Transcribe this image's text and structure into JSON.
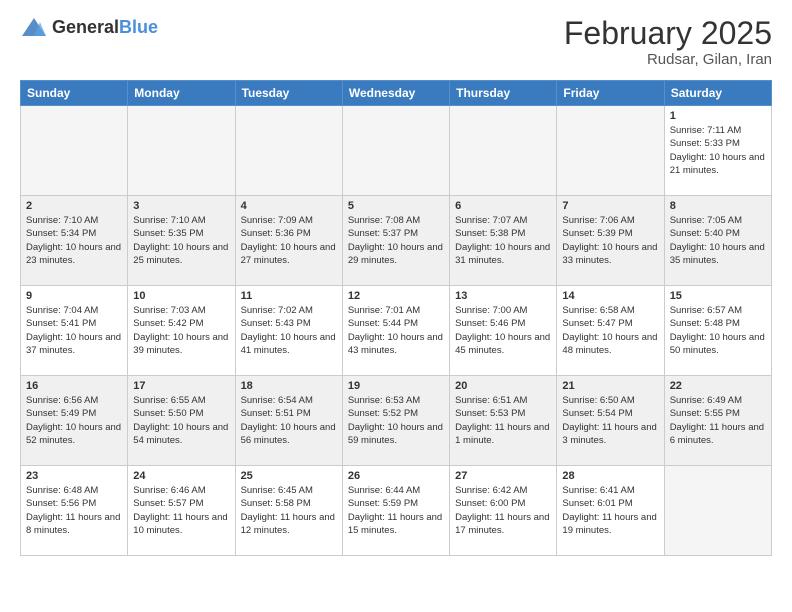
{
  "header": {
    "logo_general": "General",
    "logo_blue": "Blue",
    "title": "February 2025",
    "subtitle": "Rudsar, Gilan, Iran"
  },
  "calendar": {
    "weekdays": [
      "Sunday",
      "Monday",
      "Tuesday",
      "Wednesday",
      "Thursday",
      "Friday",
      "Saturday"
    ],
    "weeks": [
      [
        {
          "day": "",
          "info": "",
          "empty": true
        },
        {
          "day": "",
          "info": "",
          "empty": true
        },
        {
          "day": "",
          "info": "",
          "empty": true
        },
        {
          "day": "",
          "info": "",
          "empty": true
        },
        {
          "day": "",
          "info": "",
          "empty": true
        },
        {
          "day": "",
          "info": "",
          "empty": true
        },
        {
          "day": "1",
          "info": "Sunrise: 7:11 AM\nSunset: 5:33 PM\nDaylight: 10 hours and 21 minutes."
        }
      ],
      [
        {
          "day": "2",
          "info": "Sunrise: 7:10 AM\nSunset: 5:34 PM\nDaylight: 10 hours and 23 minutes."
        },
        {
          "day": "3",
          "info": "Sunrise: 7:10 AM\nSunset: 5:35 PM\nDaylight: 10 hours and 25 minutes."
        },
        {
          "day": "4",
          "info": "Sunrise: 7:09 AM\nSunset: 5:36 PM\nDaylight: 10 hours and 27 minutes."
        },
        {
          "day": "5",
          "info": "Sunrise: 7:08 AM\nSunset: 5:37 PM\nDaylight: 10 hours and 29 minutes."
        },
        {
          "day": "6",
          "info": "Sunrise: 7:07 AM\nSunset: 5:38 PM\nDaylight: 10 hours and 31 minutes."
        },
        {
          "day": "7",
          "info": "Sunrise: 7:06 AM\nSunset: 5:39 PM\nDaylight: 10 hours and 33 minutes."
        },
        {
          "day": "8",
          "info": "Sunrise: 7:05 AM\nSunset: 5:40 PM\nDaylight: 10 hours and 35 minutes."
        }
      ],
      [
        {
          "day": "9",
          "info": "Sunrise: 7:04 AM\nSunset: 5:41 PM\nDaylight: 10 hours and 37 minutes."
        },
        {
          "day": "10",
          "info": "Sunrise: 7:03 AM\nSunset: 5:42 PM\nDaylight: 10 hours and 39 minutes."
        },
        {
          "day": "11",
          "info": "Sunrise: 7:02 AM\nSunset: 5:43 PM\nDaylight: 10 hours and 41 minutes."
        },
        {
          "day": "12",
          "info": "Sunrise: 7:01 AM\nSunset: 5:44 PM\nDaylight: 10 hours and 43 minutes."
        },
        {
          "day": "13",
          "info": "Sunrise: 7:00 AM\nSunset: 5:46 PM\nDaylight: 10 hours and 45 minutes."
        },
        {
          "day": "14",
          "info": "Sunrise: 6:58 AM\nSunset: 5:47 PM\nDaylight: 10 hours and 48 minutes."
        },
        {
          "day": "15",
          "info": "Sunrise: 6:57 AM\nSunset: 5:48 PM\nDaylight: 10 hours and 50 minutes."
        }
      ],
      [
        {
          "day": "16",
          "info": "Sunrise: 6:56 AM\nSunset: 5:49 PM\nDaylight: 10 hours and 52 minutes."
        },
        {
          "day": "17",
          "info": "Sunrise: 6:55 AM\nSunset: 5:50 PM\nDaylight: 10 hours and 54 minutes."
        },
        {
          "day": "18",
          "info": "Sunrise: 6:54 AM\nSunset: 5:51 PM\nDaylight: 10 hours and 56 minutes."
        },
        {
          "day": "19",
          "info": "Sunrise: 6:53 AM\nSunset: 5:52 PM\nDaylight: 10 hours and 59 minutes."
        },
        {
          "day": "20",
          "info": "Sunrise: 6:51 AM\nSunset: 5:53 PM\nDaylight: 11 hours and 1 minute."
        },
        {
          "day": "21",
          "info": "Sunrise: 6:50 AM\nSunset: 5:54 PM\nDaylight: 11 hours and 3 minutes."
        },
        {
          "day": "22",
          "info": "Sunrise: 6:49 AM\nSunset: 5:55 PM\nDaylight: 11 hours and 6 minutes."
        }
      ],
      [
        {
          "day": "23",
          "info": "Sunrise: 6:48 AM\nSunset: 5:56 PM\nDaylight: 11 hours and 8 minutes."
        },
        {
          "day": "24",
          "info": "Sunrise: 6:46 AM\nSunset: 5:57 PM\nDaylight: 11 hours and 10 minutes."
        },
        {
          "day": "25",
          "info": "Sunrise: 6:45 AM\nSunset: 5:58 PM\nDaylight: 11 hours and 12 minutes."
        },
        {
          "day": "26",
          "info": "Sunrise: 6:44 AM\nSunset: 5:59 PM\nDaylight: 11 hours and 15 minutes."
        },
        {
          "day": "27",
          "info": "Sunrise: 6:42 AM\nSunset: 6:00 PM\nDaylight: 11 hours and 17 minutes."
        },
        {
          "day": "28",
          "info": "Sunrise: 6:41 AM\nSunset: 6:01 PM\nDaylight: 11 hours and 19 minutes."
        },
        {
          "day": "",
          "info": "",
          "empty": true
        }
      ]
    ]
  }
}
